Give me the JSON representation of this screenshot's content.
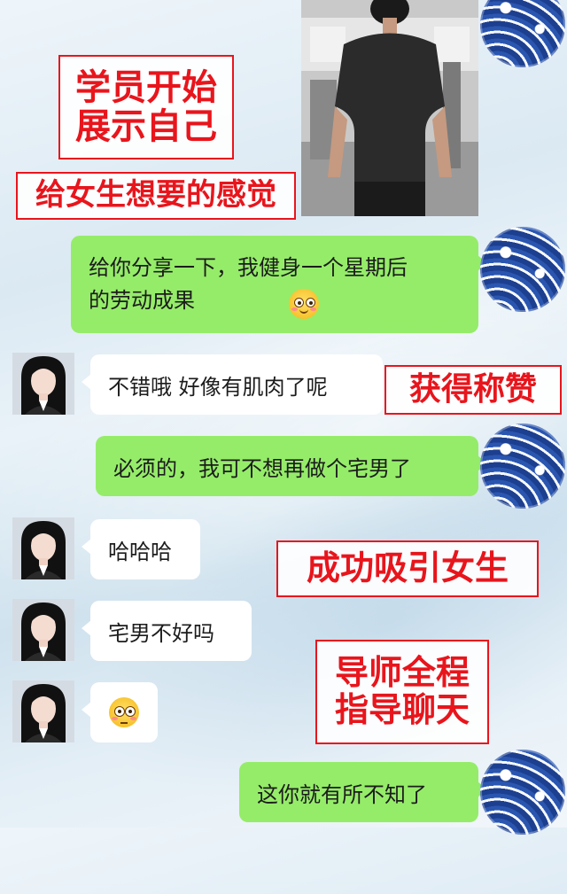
{
  "labels": {
    "show_self": "学员开始\n展示自己",
    "give_feeling": "给女生想要的感觉",
    "praise": "获得称赞",
    "attract": "成功吸引女生",
    "mentor": "导师全程\n指导聊天"
  },
  "messages": [
    {
      "side": "right",
      "text": "给你分享一下，我健身一个星期后\n的劳动成果",
      "emoji": "smirk-emoji"
    },
    {
      "side": "left",
      "text": "不错哦 好像有肌肉了呢"
    },
    {
      "side": "right",
      "text": "必须的，我可不想再做个宅男了"
    },
    {
      "side": "left",
      "text": "哈哈哈"
    },
    {
      "side": "left",
      "text": "宅男不好吗"
    },
    {
      "side": "left",
      "text": "",
      "emoji": "flushed-emoji"
    },
    {
      "side": "right",
      "text": "这你就有所不知了"
    }
  ],
  "colors": {
    "sent_bubble": "#95ec69",
    "received_bubble": "#ffffff",
    "label_red": "#e8151c"
  },
  "icons": {
    "self_avatar": "wave-pattern-avatar",
    "contact_avatar": "girl-avatar",
    "photo": "gym-back-photo"
  }
}
